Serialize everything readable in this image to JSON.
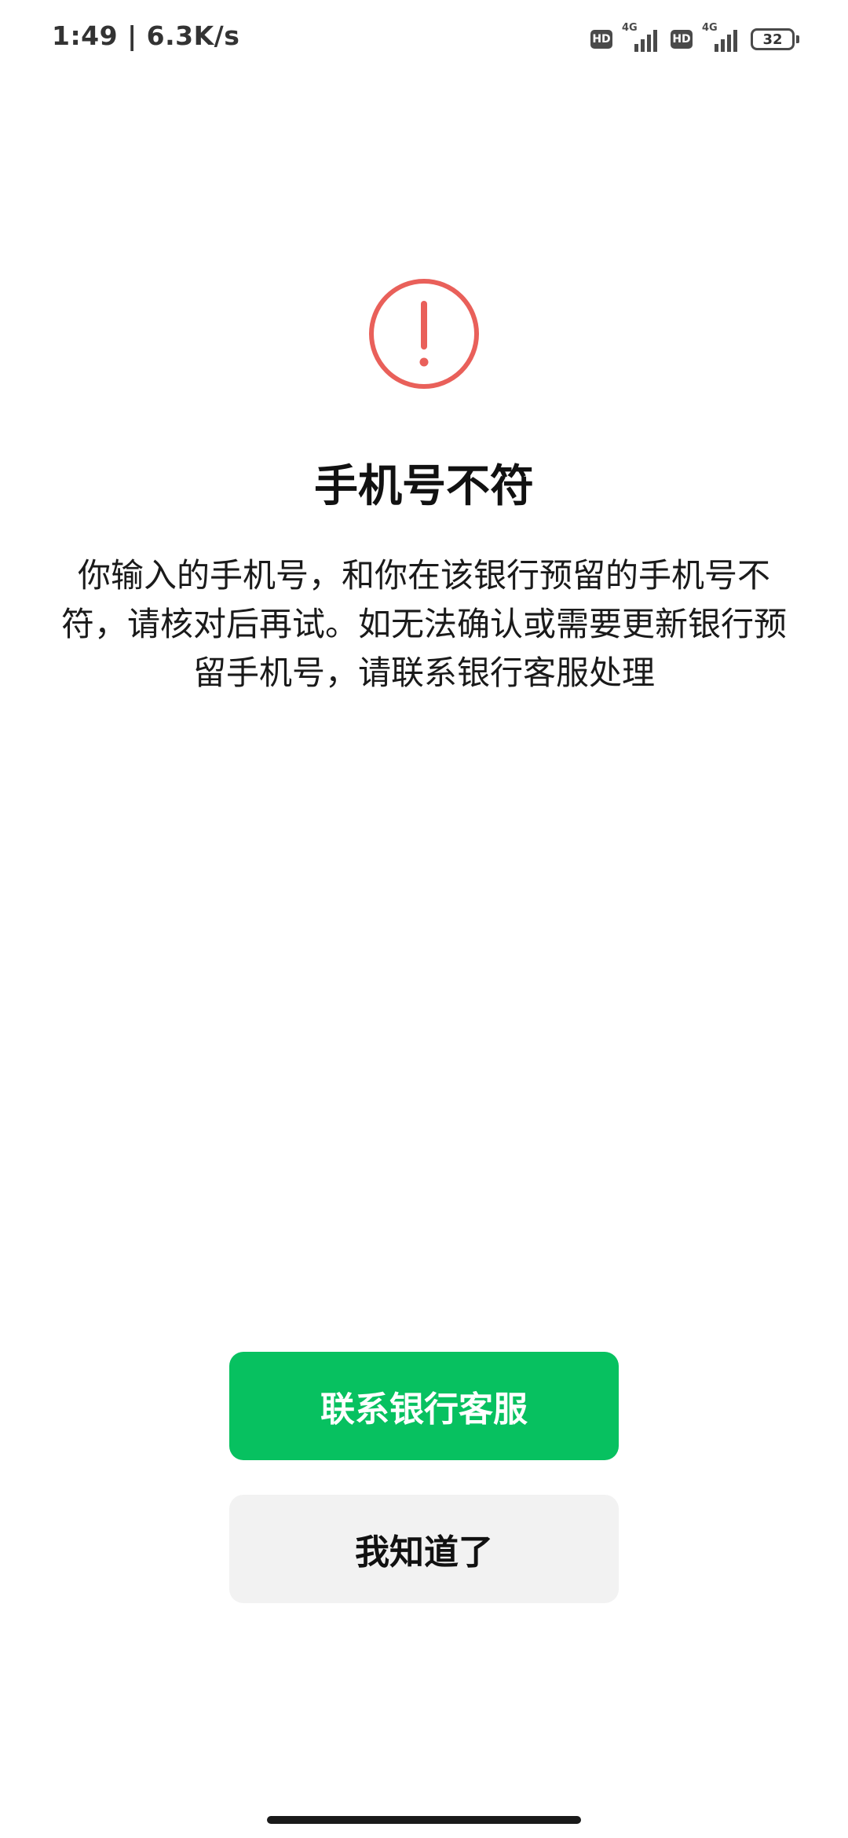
{
  "status_bar": {
    "time_speed": "1:49 | 6.3K/s",
    "sim1": {
      "badge": "HD",
      "network": "4G"
    },
    "sim2": {
      "badge": "HD",
      "network": "4G"
    },
    "battery_level": "32"
  },
  "dialog": {
    "icon": "exclamation-circle-icon",
    "icon_color": "#e9605a",
    "title": "手机号不符",
    "message": "你输入的手机号，和你在该银行预留的手机号不符，请核对后再试。如无法确认或需要更新银行预留手机号，请联系银行客服处理"
  },
  "buttons": {
    "contact_bank": "联系银行客服",
    "acknowledge": "我知道了"
  },
  "colors": {
    "primary": "#07c160",
    "secondary_bg": "#f2f2f2"
  }
}
